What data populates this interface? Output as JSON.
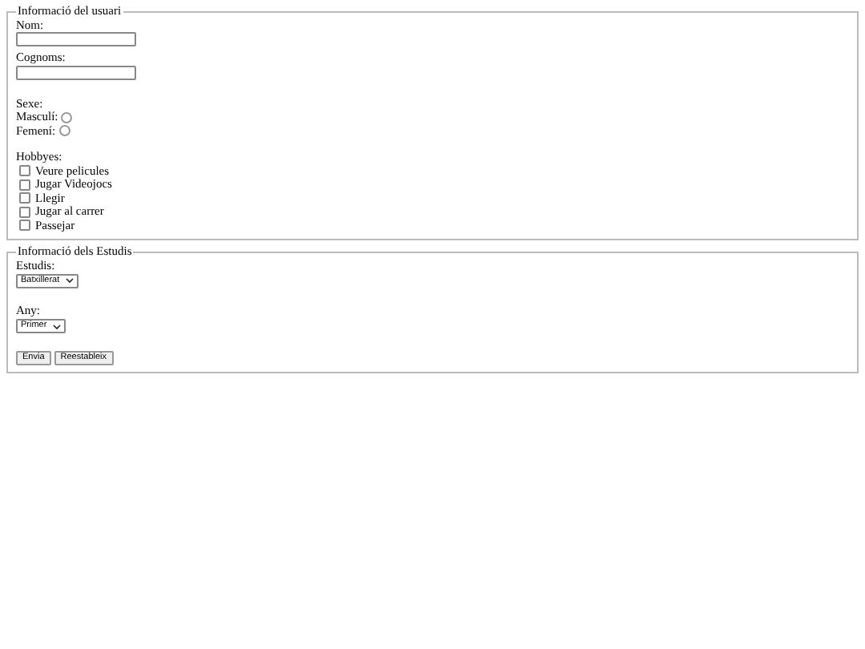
{
  "user_info": {
    "legend": "Informació del usuari",
    "fields": [
      {
        "label": "Nom:"
      },
      {
        "label": "Cognoms:"
      }
    ],
    "sex": {
      "label": "Sexe:",
      "options": [
        {
          "label": "Masculí:",
          "selected": false
        },
        {
          "label": "Femení:",
          "selected": false
        }
      ]
    },
    "hobbies": {
      "label": "Hobbyes:",
      "items": [
        {
          "label": "Veure pelicules",
          "checked": false
        },
        {
          "label": "Jugar Videojocs",
          "checked": false
        },
        {
          "label": "Llegir",
          "checked": false
        },
        {
          "label": "Jugar al carrer",
          "checked": false
        },
        {
          "label": "Passejar",
          "checked": false
        }
      ]
    }
  },
  "studies": {
    "legend": "Informació dels Estudis",
    "selects": [
      {
        "label": "Estudis:",
        "value": "Batxillerat"
      },
      {
        "label": "Any:",
        "value": "Primer"
      }
    ],
    "buttons": [
      "Envia",
      "Reestableix"
    ]
  }
}
